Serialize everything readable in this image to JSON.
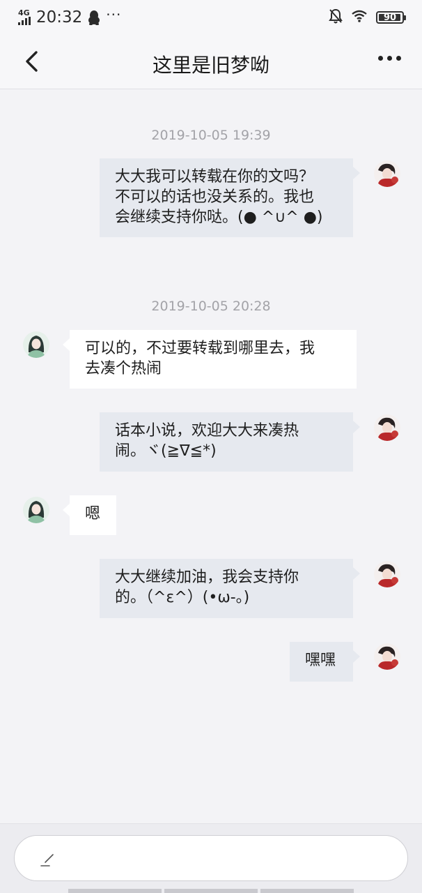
{
  "status_bar": {
    "network": "4G",
    "time": "20:32",
    "qq_icon": "penguin-icon",
    "more_dots": "···",
    "battery": "90"
  },
  "header": {
    "title": "这里是旧梦呦",
    "back_icon": "chevron-left-icon",
    "more_icon": "ellipsis-icon"
  },
  "messages": [
    {
      "type": "timestamp",
      "text": "2019-10-05 19:39"
    },
    {
      "type": "out",
      "lines": [
        "大大我可以转载在你的文吗？",
        "不可以的话也没关系的。我也",
        "会继续支持你哒。(● ^∪^ ●)"
      ]
    },
    {
      "type": "timestamp",
      "text": "2019-10-05 20:28"
    },
    {
      "type": "in",
      "lines": [
        "可以的，不过要转载到哪里去，我",
        "去凑个热闹"
      ]
    },
    {
      "type": "out",
      "lines": [
        "话本小说，欢迎大大来凑热",
        "闹。ヾ(≧∇≦*)"
      ]
    },
    {
      "type": "in",
      "lines": [
        "嗯"
      ]
    },
    {
      "type": "out",
      "lines": [
        "大大继续加油，我会支持你",
        "的。（^ε^）(•ω-。)"
      ]
    },
    {
      "type": "out",
      "lines": [
        "嘿嘿"
      ]
    }
  ],
  "input": {
    "placeholder": "",
    "pen_icon": "pen-icon"
  },
  "colors": {
    "outgoing_bubble": "#e6e9ef",
    "incoming_bubble": "#ffffff",
    "timestamp": "#a3a3a8",
    "background": "#f3f3f6"
  }
}
